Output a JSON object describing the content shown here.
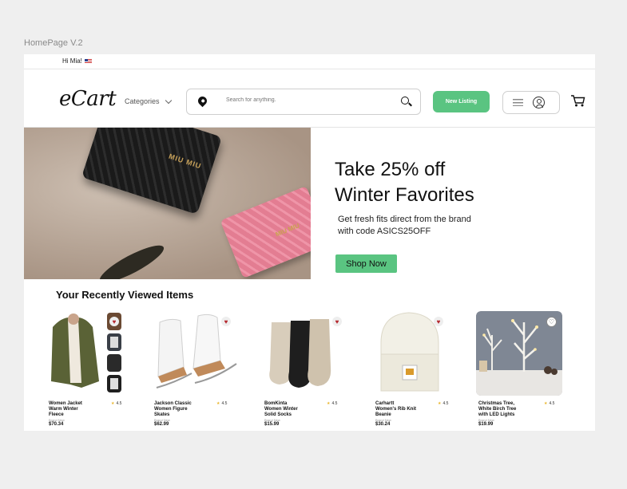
{
  "frame_label": "HomePage V.2",
  "topbar": {
    "greeting": "Hi Mia!"
  },
  "header": {
    "logo": "eCart",
    "categories_label": "Categories",
    "search_placeholder": "Search for anything.",
    "new_listing_label": "New Listing"
  },
  "hero": {
    "title_line1": "Take 25% off",
    "title_line2": "Winter Favorites",
    "subtitle_line1": "Get fresh fits direct from the brand",
    "subtitle_line2": "with code ASICS25OFF",
    "cta_label": "Shop Now",
    "wallet_emboss": "MIU MIU",
    "card_emboss": "MIU MIU"
  },
  "recent": {
    "title": "Your Recently Viewed Items",
    "items": [
      {
        "name_line1": "Women Jacket",
        "name_line2": "Warm Winter",
        "name_line3": "Fleece",
        "brand": "Brand New",
        "price": "$70.34",
        "rating": "4.5",
        "favorited": true
      },
      {
        "name_line1": "Jackson Classic",
        "name_line2": "Women Figure",
        "name_line3": "Skates",
        "brand": "Brand New",
        "price": "$62.99",
        "rating": "4.5",
        "favorited": true
      },
      {
        "name_line1": "BomKinta",
        "name_line2": "Women Winter",
        "name_line3": "Solid Socks",
        "brand": "Brand New",
        "price": "$15.99",
        "rating": "4.5",
        "favorited": true
      },
      {
        "name_line1": "Carhartt",
        "name_line2": "Women's Rib Knit",
        "name_line3": "Beanie",
        "brand": "Brand New",
        "price": "$30.24",
        "rating": "4.5",
        "favorited": true
      },
      {
        "name_line1": "Christmas Tree,",
        "name_line2": "White Birch Tree",
        "name_line3": "with LED Lights",
        "brand": "Brand New",
        "price": "$19.99",
        "rating": "4.5",
        "favorited": false
      }
    ]
  },
  "colors": {
    "accent_green": "#5ac481",
    "heart_red": "#b5272d",
    "star_yellow": "#e9b52b"
  },
  "icons": [
    "location-pin-icon",
    "search-icon",
    "menu-icon",
    "user-icon",
    "cart-icon",
    "chevron-down-icon",
    "heart-icon",
    "star-icon",
    "flag-icon"
  ]
}
